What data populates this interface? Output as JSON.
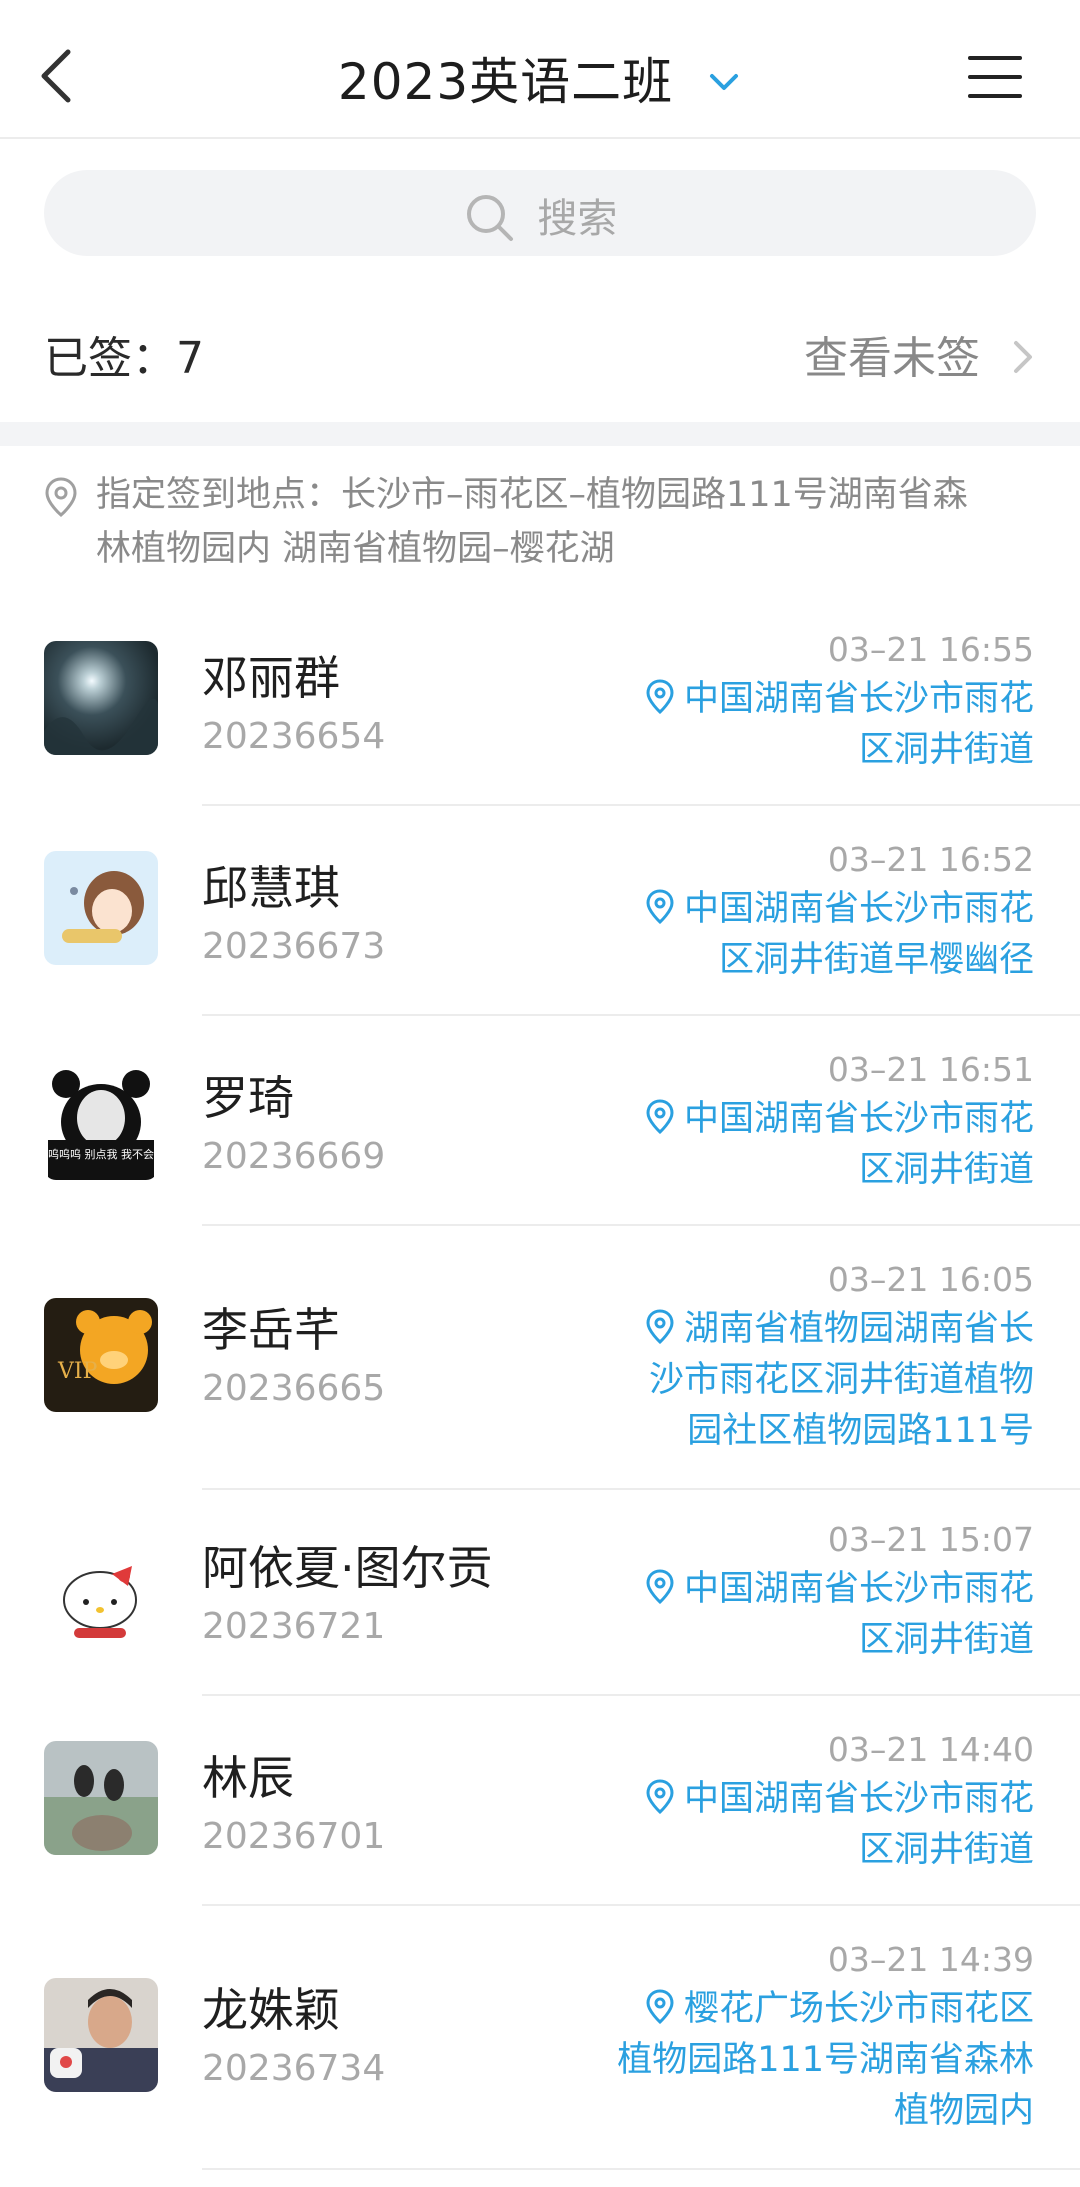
{
  "header": {
    "title": "2023英语二班"
  },
  "search": {
    "placeholder": "搜索"
  },
  "stats": {
    "signed": "已签：7",
    "unsigned": "查看未签"
  },
  "location": {
    "line1": "指定签到地点：长沙市–雨花区–植物园路111号湖南省森",
    "line2": "林植物园内 湖南省植物园–樱花湖"
  },
  "records": [
    {
      "name": "邓丽群",
      "sid": "20236654",
      "time": "03–21 16:55",
      "addr": [
        "中国湖南省长沙市雨花",
        "区洞井街道"
      ]
    },
    {
      "name": "邱慧琪",
      "sid": "20236673",
      "time": "03–21 16:52",
      "addr": [
        "中国湖南省长沙市雨花",
        "区洞井街道早樱幽径"
      ]
    },
    {
      "name": "罗琦",
      "sid": "20236669",
      "time": "03–21 16:51",
      "addr": [
        "中国湖南省长沙市雨花",
        "区洞井街道"
      ]
    },
    {
      "name": "李岳芊",
      "sid": "20236665",
      "time": "03–21 16:05",
      "addr": [
        "湖南省植物园湖南省长",
        "沙市雨花区洞井街道植物",
        "园社区植物园路111号"
      ]
    },
    {
      "name": "阿依夏·图尔贡",
      "sid": "20236721",
      "time": "03–21 15:07",
      "addr": [
        "中国湖南省长沙市雨花",
        "区洞井街道"
      ]
    },
    {
      "name": "林辰",
      "sid": "20236701",
      "time": "03–21 14:40",
      "addr": [
        "中国湖南省长沙市雨花",
        "区洞井街道"
      ]
    },
    {
      "name": "龙姝颖",
      "sid": "20236734",
      "time": "03–21 14:39",
      "addr": [
        "樱花广场长沙市雨花区",
        "植物园路111号湖南省森林",
        "植物园内"
      ]
    }
  ],
  "avatar_texts": {
    "panda_caption": "呜呜呜 别点我 我不会",
    "vip": "VIP"
  },
  "colors": {
    "accent": "#2aa0e0",
    "muted": "#a8a8a8"
  }
}
